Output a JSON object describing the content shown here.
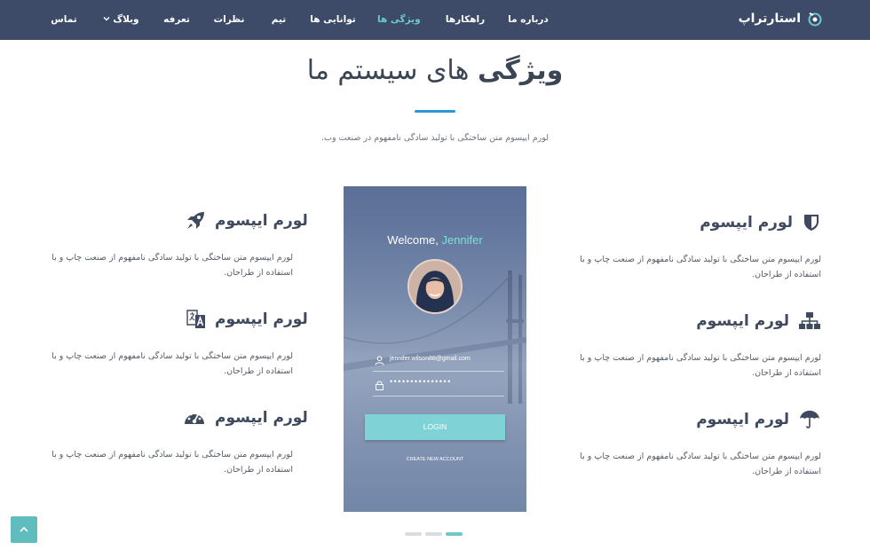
{
  "brand": {
    "name": "استارتراپ",
    "icon": "brand-logo-icon"
  },
  "nav": {
    "items": [
      {
        "label": "درباره ما",
        "active": false
      },
      {
        "label": "راهکارها",
        "active": false
      },
      {
        "label": "ویژگی ها",
        "active": true
      },
      {
        "label": "توانایی ها",
        "active": false
      },
      {
        "label": "تیم",
        "active": false
      },
      {
        "label": "نظرات",
        "active": false
      },
      {
        "label": "تعرفه",
        "active": false
      },
      {
        "label": "وبلاگ",
        "active": false,
        "dropdown": true
      },
      {
        "label": "تماس",
        "active": false
      }
    ]
  },
  "section": {
    "title_strong": "ویژگی",
    "title_rest": "های سیستم ما",
    "subtitle": "لورم ایپسوم متن ساختگی با تولید سادگی نامفهوم در صنعت وب."
  },
  "features": {
    "right": [
      {
        "title": "لورم ایپسوم",
        "icon": "shield-icon",
        "text": "لورم ایپسوم متن ساختگی با تولید سادگی نامفهوم از صنعت چاپ و با استفاده از طراحان."
      },
      {
        "title": "لورم ایپسوم",
        "icon": "sitemap-icon",
        "text": "لورم ایپسوم متن ساختگی با تولید سادگی نامفهوم از صنعت چاپ و با استفاده از طراحان."
      },
      {
        "title": "لورم ایپسوم",
        "icon": "umbrella-icon",
        "text": "لورم ایپسوم متن ساختگی با تولید سادگی نامفهوم از صنعت چاپ و با استفاده از طراحان."
      }
    ],
    "left": [
      {
        "title": "لورم ایپسوم",
        "icon": "rocket-icon",
        "text": "لورم ایپسوم متن ساختگی با تولید سادگی نامفهوم از صنعت چاپ و با استفاده از طراحان."
      },
      {
        "title": "لورم ایپسوم",
        "icon": "translate-icon",
        "text": "لورم ایپسوم متن ساختگی با تولید سادگی نامفهوم از صنعت چاپ و با استفاده از طراحان."
      },
      {
        "title": "لورم ایپسوم",
        "icon": "dashboard-icon",
        "text": "لورم ایپسوم متن ساختگی با تولید سادگی نامفهوم از صنعت چاپ و با استفاده از طراحان."
      }
    ]
  },
  "phone": {
    "welcome": "Welcome,",
    "welcome_name": "Jennifer",
    "email": "jennifer.wilson88@gmail.com",
    "password_mask": "•••••••••••••••",
    "login_label": "LOGIN",
    "create_label": "CREATE NEW ACCOUNT"
  },
  "carousel": {
    "count": 3,
    "active_index": 2
  },
  "colors": {
    "navbar": "#3d4b69",
    "accent_teal": "#6cc9c9",
    "title_rule": "#2b97d6",
    "icon": "#3f4a5e"
  }
}
